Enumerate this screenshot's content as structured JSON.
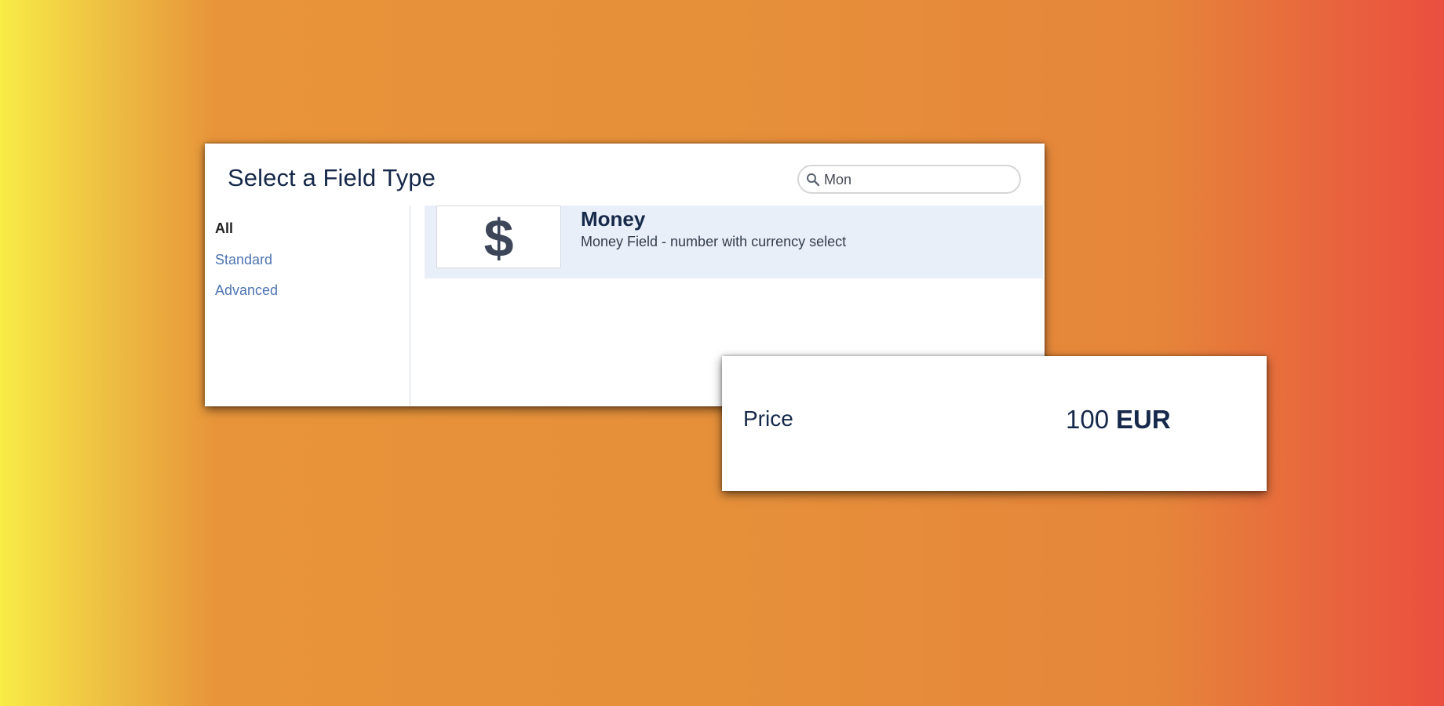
{
  "dialog": {
    "title": "Select a Field Type",
    "search": {
      "value": "Mon",
      "icon": "search-icon"
    },
    "sidebar": {
      "items": [
        {
          "label": "All",
          "active": true
        },
        {
          "label": "Standard",
          "active": false
        },
        {
          "label": "Advanced",
          "active": false
        }
      ]
    },
    "results": [
      {
        "icon": "dollar-sign-icon",
        "icon_glyph": "$",
        "title": "Money",
        "description": "Money Field - number with currency select"
      }
    ]
  },
  "preview": {
    "label": "Price",
    "value": "100",
    "currency": "EUR"
  },
  "colors": {
    "title_text": "#16294a",
    "link": "#4d74b3",
    "selected_row_bg": "#e9eff8",
    "background_gradient": [
      "#f8ec46",
      "#e6903a",
      "#ea4f3f"
    ]
  }
}
